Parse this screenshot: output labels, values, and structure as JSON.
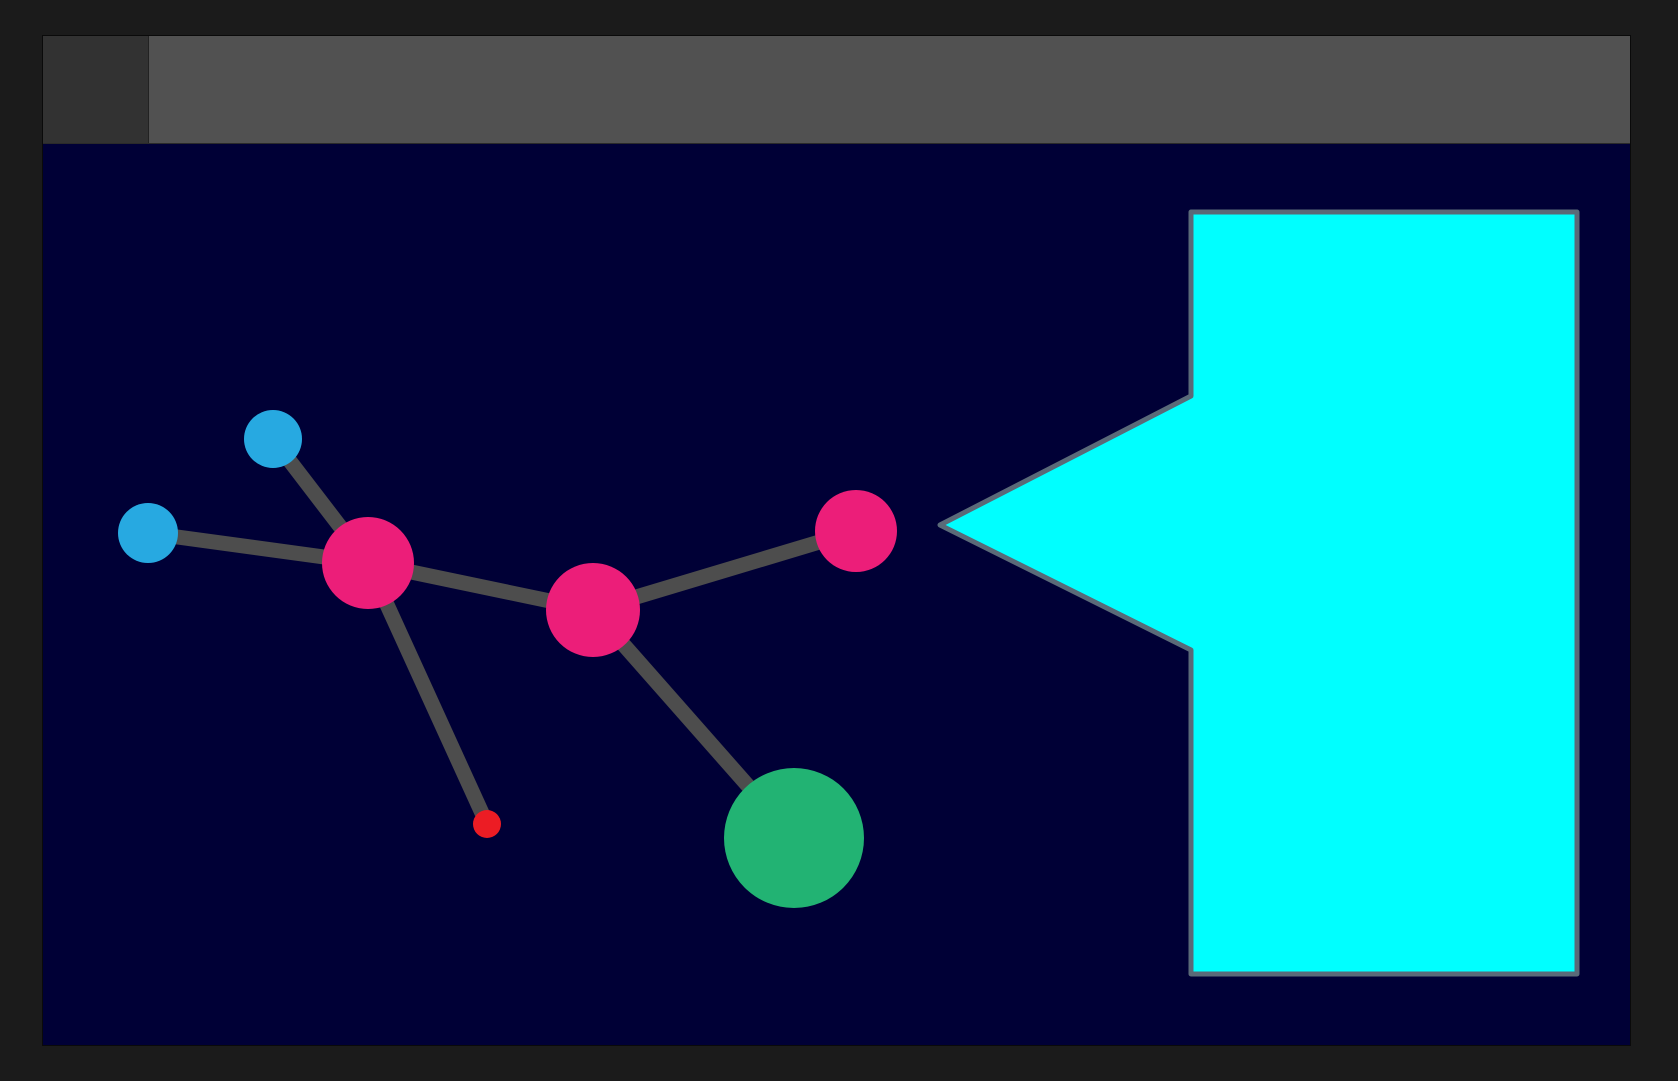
{
  "colors": {
    "frame": "#1b1b1b",
    "titlebar": "#515151",
    "titlebar_button": "#323232",
    "canvas": "#000036",
    "edge": "#4d4d4d",
    "node_magenta": "#ec1e79",
    "node_blue": "#27a9e1",
    "node_red": "#ec1c24",
    "node_green": "#22b373",
    "callout_fill": "#00ffff",
    "callout_stroke": "#5a6a78"
  },
  "diagram": {
    "nodes": [
      {
        "id": "hub",
        "kind": "magenta-node"
      },
      {
        "id": "center",
        "kind": "magenta-node"
      },
      {
        "id": "right",
        "kind": "magenta-node"
      },
      {
        "id": "top-left",
        "kind": "blue-node"
      },
      {
        "id": "left",
        "kind": "blue-node"
      },
      {
        "id": "small",
        "kind": "red-node"
      },
      {
        "id": "large",
        "kind": "green-node"
      }
    ],
    "edges": [
      {
        "from": "hub",
        "to": "top-left"
      },
      {
        "from": "hub",
        "to": "left"
      },
      {
        "from": "hub",
        "to": "center"
      },
      {
        "from": "hub",
        "to": "small"
      },
      {
        "from": "center",
        "to": "right"
      },
      {
        "from": "center",
        "to": "large"
      }
    ],
    "callout": {
      "kind": "speech-callout",
      "points_to": "right"
    }
  }
}
